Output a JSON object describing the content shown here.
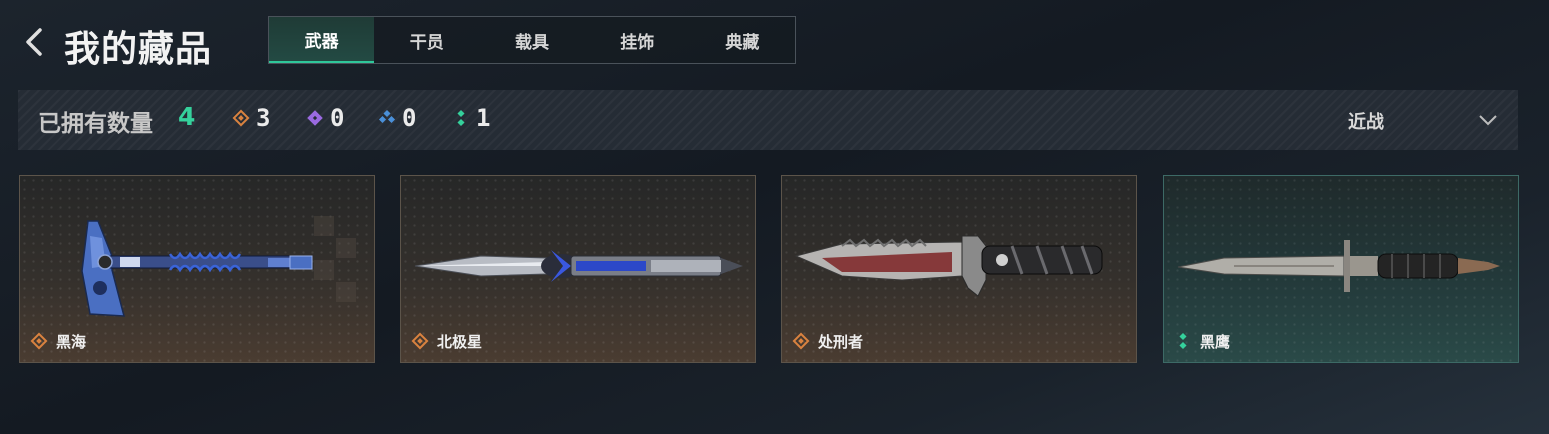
{
  "header": {
    "title": "我的藏品",
    "tabs": [
      {
        "label": "武器",
        "active": true
      },
      {
        "label": "干员",
        "active": false
      },
      {
        "label": "载具",
        "active": false
      },
      {
        "label": "挂饰",
        "active": false
      },
      {
        "label": "典藏",
        "active": false
      }
    ]
  },
  "summary": {
    "owned_label": "已拥有数量",
    "owned_count": "4",
    "rarity_counts": [
      {
        "icon": "orange-diamond-icon",
        "color": "#d9823f",
        "count": "3"
      },
      {
        "icon": "purple-diamond-icon",
        "color": "#9a6ae0",
        "count": "0"
      },
      {
        "icon": "blue-diamond-icon",
        "color": "#4a90d9",
        "count": "0"
      },
      {
        "icon": "green-dots-icon",
        "color": "#35d19c",
        "count": "1"
      }
    ],
    "filter": {
      "selected": "近战",
      "icon": "chevron-down-icon"
    }
  },
  "items": [
    {
      "name": "黑海",
      "rarity_icon": "orange-diamond-icon",
      "rarity_color": "#d9823f"
    },
    {
      "name": "北极星",
      "rarity_icon": "orange-diamond-icon",
      "rarity_color": "#d9823f"
    },
    {
      "name": "处刑者",
      "rarity_icon": "orange-diamond-icon",
      "rarity_color": "#d9823f"
    },
    {
      "name": "黑鹰",
      "rarity_icon": "green-dots-icon",
      "rarity_color": "#35d19c"
    }
  ],
  "colors": {
    "accent": "#35d19c",
    "active_tab": "#234a43"
  }
}
